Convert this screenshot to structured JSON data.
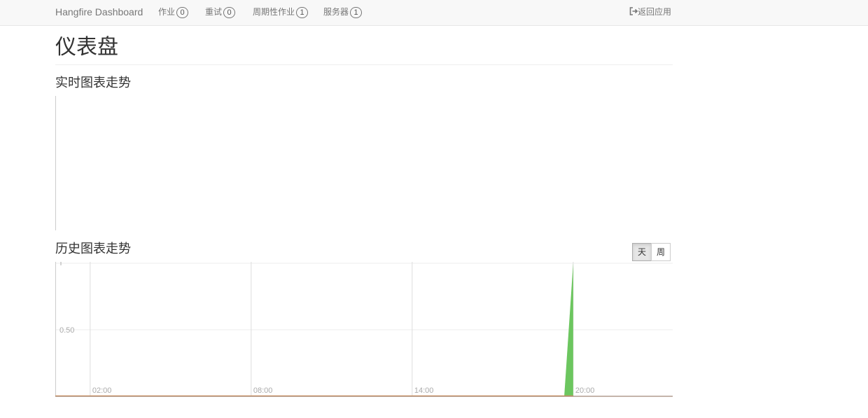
{
  "navbar": {
    "brand": "Hangfire Dashboard",
    "items": [
      {
        "label": "作业",
        "count": "0"
      },
      {
        "label": "重试",
        "count": "0"
      },
      {
        "label": "周期性作业",
        "count": "1"
      },
      {
        "label": "服务器",
        "count": "1"
      }
    ],
    "back_label": "返回应用",
    "back_icon": "sign-out-icon"
  },
  "page": {
    "title": "仪表盘",
    "realtime_heading": "实时图表走势",
    "history_heading": "历史图表走势"
  },
  "range_buttons": [
    {
      "label": "天",
      "active": true
    },
    {
      "label": "周",
      "active": false
    }
  ],
  "chart_data": {
    "type": "area",
    "x_tick_labels": [
      "02:00",
      "08:00",
      "14:00",
      "20:00"
    ],
    "y_tick_labels": [
      "0.50"
    ],
    "ylim": [
      0,
      1
    ],
    "grid": true,
    "series": [
      {
        "color": "#6cc65f",
        "points": [
          [
            "19:40",
            0
          ],
          [
            "20:00",
            1
          ]
        ]
      },
      {
        "color": "#e8a46b",
        "points": [
          [
            "00:00",
            0
          ],
          [
            "20:00",
            0
          ]
        ]
      }
    ]
  }
}
